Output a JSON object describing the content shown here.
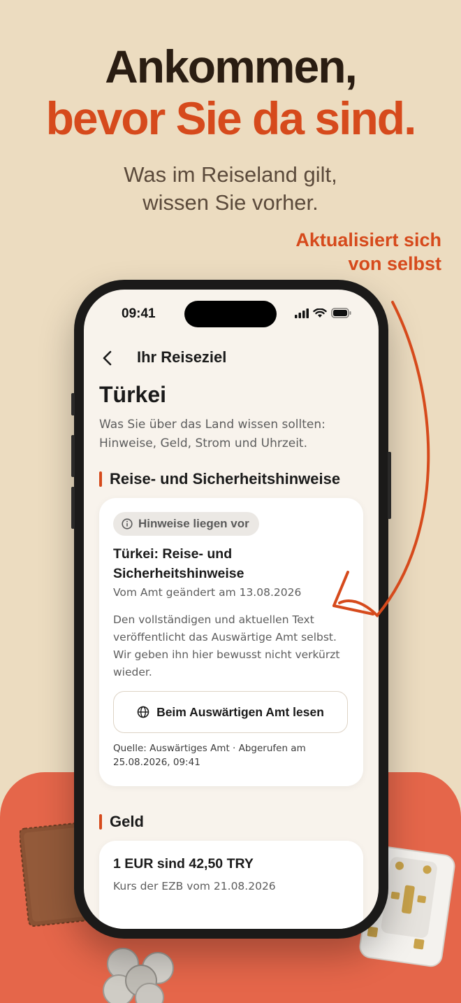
{
  "headline": {
    "line1": "Ankommen,",
    "line2": "bevor Sie da sind."
  },
  "subline": {
    "line1": "Was im Reiseland gilt,",
    "line2": "wissen Sie vorher."
  },
  "annotation": {
    "line1": "Aktualisiert sich",
    "line2": "von selbst"
  },
  "colors": {
    "accent": "#d64a1c",
    "background": "#ecdcc0",
    "blob": "#e5664a"
  },
  "phone": {
    "status": {
      "time": "09:41",
      "icons": [
        "signal-icon",
        "wifi-icon",
        "battery-icon"
      ]
    },
    "nav": {
      "title": "Ihr Reiseziel",
      "back_icon": "chevron-left-icon"
    },
    "country": "Türkei",
    "intro": "Was Sie über das Land wissen sollten: Hinweise, Geld, Strom und Uhrzeit.",
    "sections": {
      "safety": {
        "title": "Reise- und Sicherheitshinweise",
        "badge": "Hinweise liegen vor",
        "card_title": "Türkei: Reise- und Sicherheitshinweise",
        "changed": "Vom Amt geändert am 13.08.2026",
        "body": "Den vollständigen und aktuellen Text veröffentlicht das Auswärtige Amt selbst. Wir geben ihn hier bewusst nicht verkürzt wieder.",
        "button": "Beim Auswärtigen Amt lesen",
        "source": "Quelle: Auswärtiges Amt · Abgerufen am 25.08.2026, 09:41"
      },
      "money": {
        "title": "Geld",
        "rate": "1 EUR sind 42,50 TRY",
        "rate_source": "Kurs der EZB vom 21.08.2026"
      }
    }
  }
}
